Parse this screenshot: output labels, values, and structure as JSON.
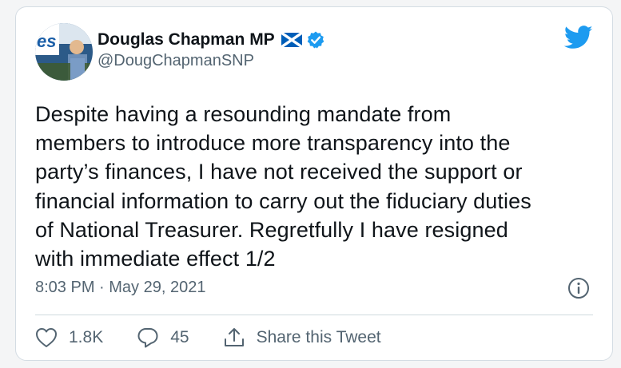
{
  "tweet": {
    "author_name": "Douglas Chapman MP",
    "handle": "@DougChapmanSNP",
    "text": "Despite having a resounding mandate from\nmembers to introduce more transparency into the\nparty’s finances, I have not received the support or\nfinancial information to carry out the fiduciary duties\nof National Treasurer. Regretfully I have resigned\nwith immediate effect 1/2",
    "timestamp": "8:03 PM · May 29, 2021",
    "likes": "1.8K",
    "replies": "45",
    "share_label": "Share this Tweet"
  },
  "icons": {
    "flag": "scotland-flag-icon",
    "verified": "verified-badge-icon",
    "brand": "twitter-bird-icon",
    "info": "info-icon",
    "like": "heart-icon",
    "reply": "reply-icon",
    "share": "share-icon"
  },
  "colors": {
    "brand_blue": "#1d9bf0",
    "text_primary": "#0f1419",
    "text_secondary": "#536471",
    "flag_blue": "#005eb8"
  }
}
